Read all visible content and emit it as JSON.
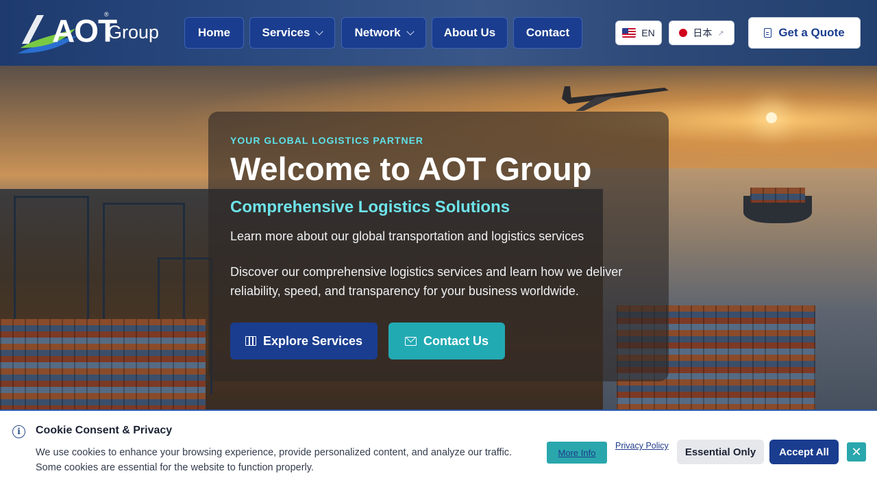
{
  "header": {
    "logo_main": "AOT",
    "logo_reg": "®",
    "logo_sub": "Group",
    "nav": [
      {
        "label": "Home"
      },
      {
        "label": "Services"
      },
      {
        "label": "Network"
      },
      {
        "label": "About Us"
      },
      {
        "label": "Contact"
      }
    ],
    "lang_en": "EN",
    "lang_jp": "日本",
    "quote_label": "Get a Quote",
    "icons": {
      "dropdown": "chevron-down-icon",
      "external": "external-link-icon",
      "quote": "document-icon",
      "flag_en": "us-flag-icon",
      "flag_jp": "jp-flag-icon"
    }
  },
  "hero": {
    "kicker": "YOUR GLOBAL LOGISTICS PARTNER",
    "title": "Welcome to AOT Group",
    "subtitle": "Comprehensive Logistics Solutions",
    "line": "Learn more about our global transportation and logistics services",
    "description": "Discover our comprehensive logistics services and learn how we deliver reliability, speed, and transparency for your business worldwide.",
    "cta_primary": "Explore Services",
    "cta_secondary": "Contact Us",
    "icons": {
      "cta_primary": "map-icon",
      "cta_secondary": "mail-icon"
    }
  },
  "cookie": {
    "title": "Cookie Consent & Privacy",
    "text_line1": "We use cookies to enhance your browsing experience, provide personalized content, and analyze our traffic.",
    "text_line2": "Some cookies are essential for the website to function properly.",
    "more_info": "More Info",
    "privacy": "Privacy Policy",
    "essential": "Essential Only",
    "accept": "Accept All",
    "close": "✕",
    "info_glyph": "i"
  },
  "colors": {
    "primary": "#1a3d8f",
    "accent_teal": "#2aa7ad",
    "accent_cyan": "#6ee3ea",
    "header_bg": "#2a4a80"
  }
}
